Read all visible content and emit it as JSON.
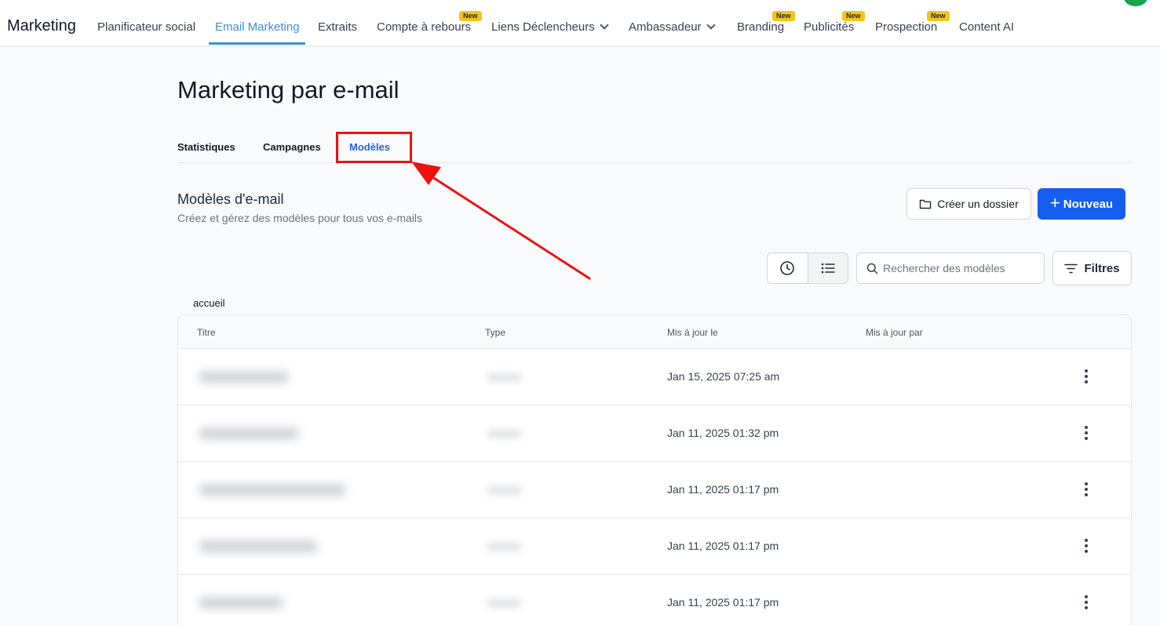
{
  "topnav": {
    "brand": "Marketing",
    "items": [
      {
        "label": "Planificateur social"
      },
      {
        "label": "Email Marketing"
      },
      {
        "label": "Extraits"
      },
      {
        "label": "Compte à rebours"
      },
      {
        "label": "Liens Déclencheurs"
      },
      {
        "label": "Ambassadeur"
      },
      {
        "label": "Branding"
      },
      {
        "label": "Publicités"
      },
      {
        "label": "Prospection"
      },
      {
        "label": "Content AI"
      }
    ],
    "badge_label": "New"
  },
  "page": {
    "title": "Marketing par e-mail",
    "tabs": [
      {
        "label": "Statistiques"
      },
      {
        "label": "Campagnes"
      },
      {
        "label": "Modèles"
      }
    ]
  },
  "section": {
    "title": "Modèles d'e-mail",
    "subtitle": "Créez et gérez des modèles pour tous vos e-mails",
    "create_folder_label": "Créer un dossier",
    "new_label": "Nouveau",
    "search_placeholder": "Rechercher des modèles",
    "filters_label": "Filtres",
    "breadcrumb": "accueil"
  },
  "table": {
    "columns": [
      "Titre",
      "Type",
      "Mis à jour le",
      "Mis à jour par"
    ],
    "rows": [
      {
        "updated": "Jan 15, 2025 07:25 am"
      },
      {
        "updated": "Jan 11, 2025 01:32 pm"
      },
      {
        "updated": "Jan 11, 2025 01:17 pm"
      },
      {
        "updated": "Jan 11, 2025 01:17 pm"
      },
      {
        "updated": "Jan 11, 2025 01:17 pm"
      }
    ]
  },
  "colors": {
    "accent": "#3b8fd6",
    "primary_button": "#155eef",
    "annotation": "#ee1111",
    "badge": "#f5c518"
  }
}
